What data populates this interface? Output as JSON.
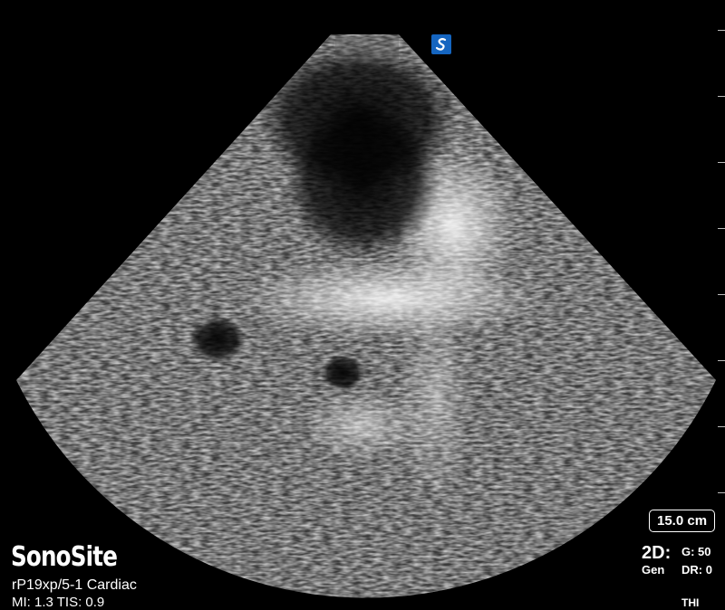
{
  "brand": {
    "name": "SonoSite"
  },
  "probe": {
    "label": "rP19xp/5-1  Cardiac"
  },
  "indices": {
    "label": "MI: 1.3  TIS: 0.9"
  },
  "depth": {
    "label": "15.0 cm"
  },
  "mode": {
    "name": "2D:",
    "sub": "Gen",
    "gain": "G: 50",
    "dr": "DR: 0",
    "thi": "THI"
  },
  "colors": {
    "background": "#000000",
    "badge": "#1565c0",
    "text": "#ffffff"
  },
  "icons": {
    "logo": "sonosite-orientation-icon"
  }
}
